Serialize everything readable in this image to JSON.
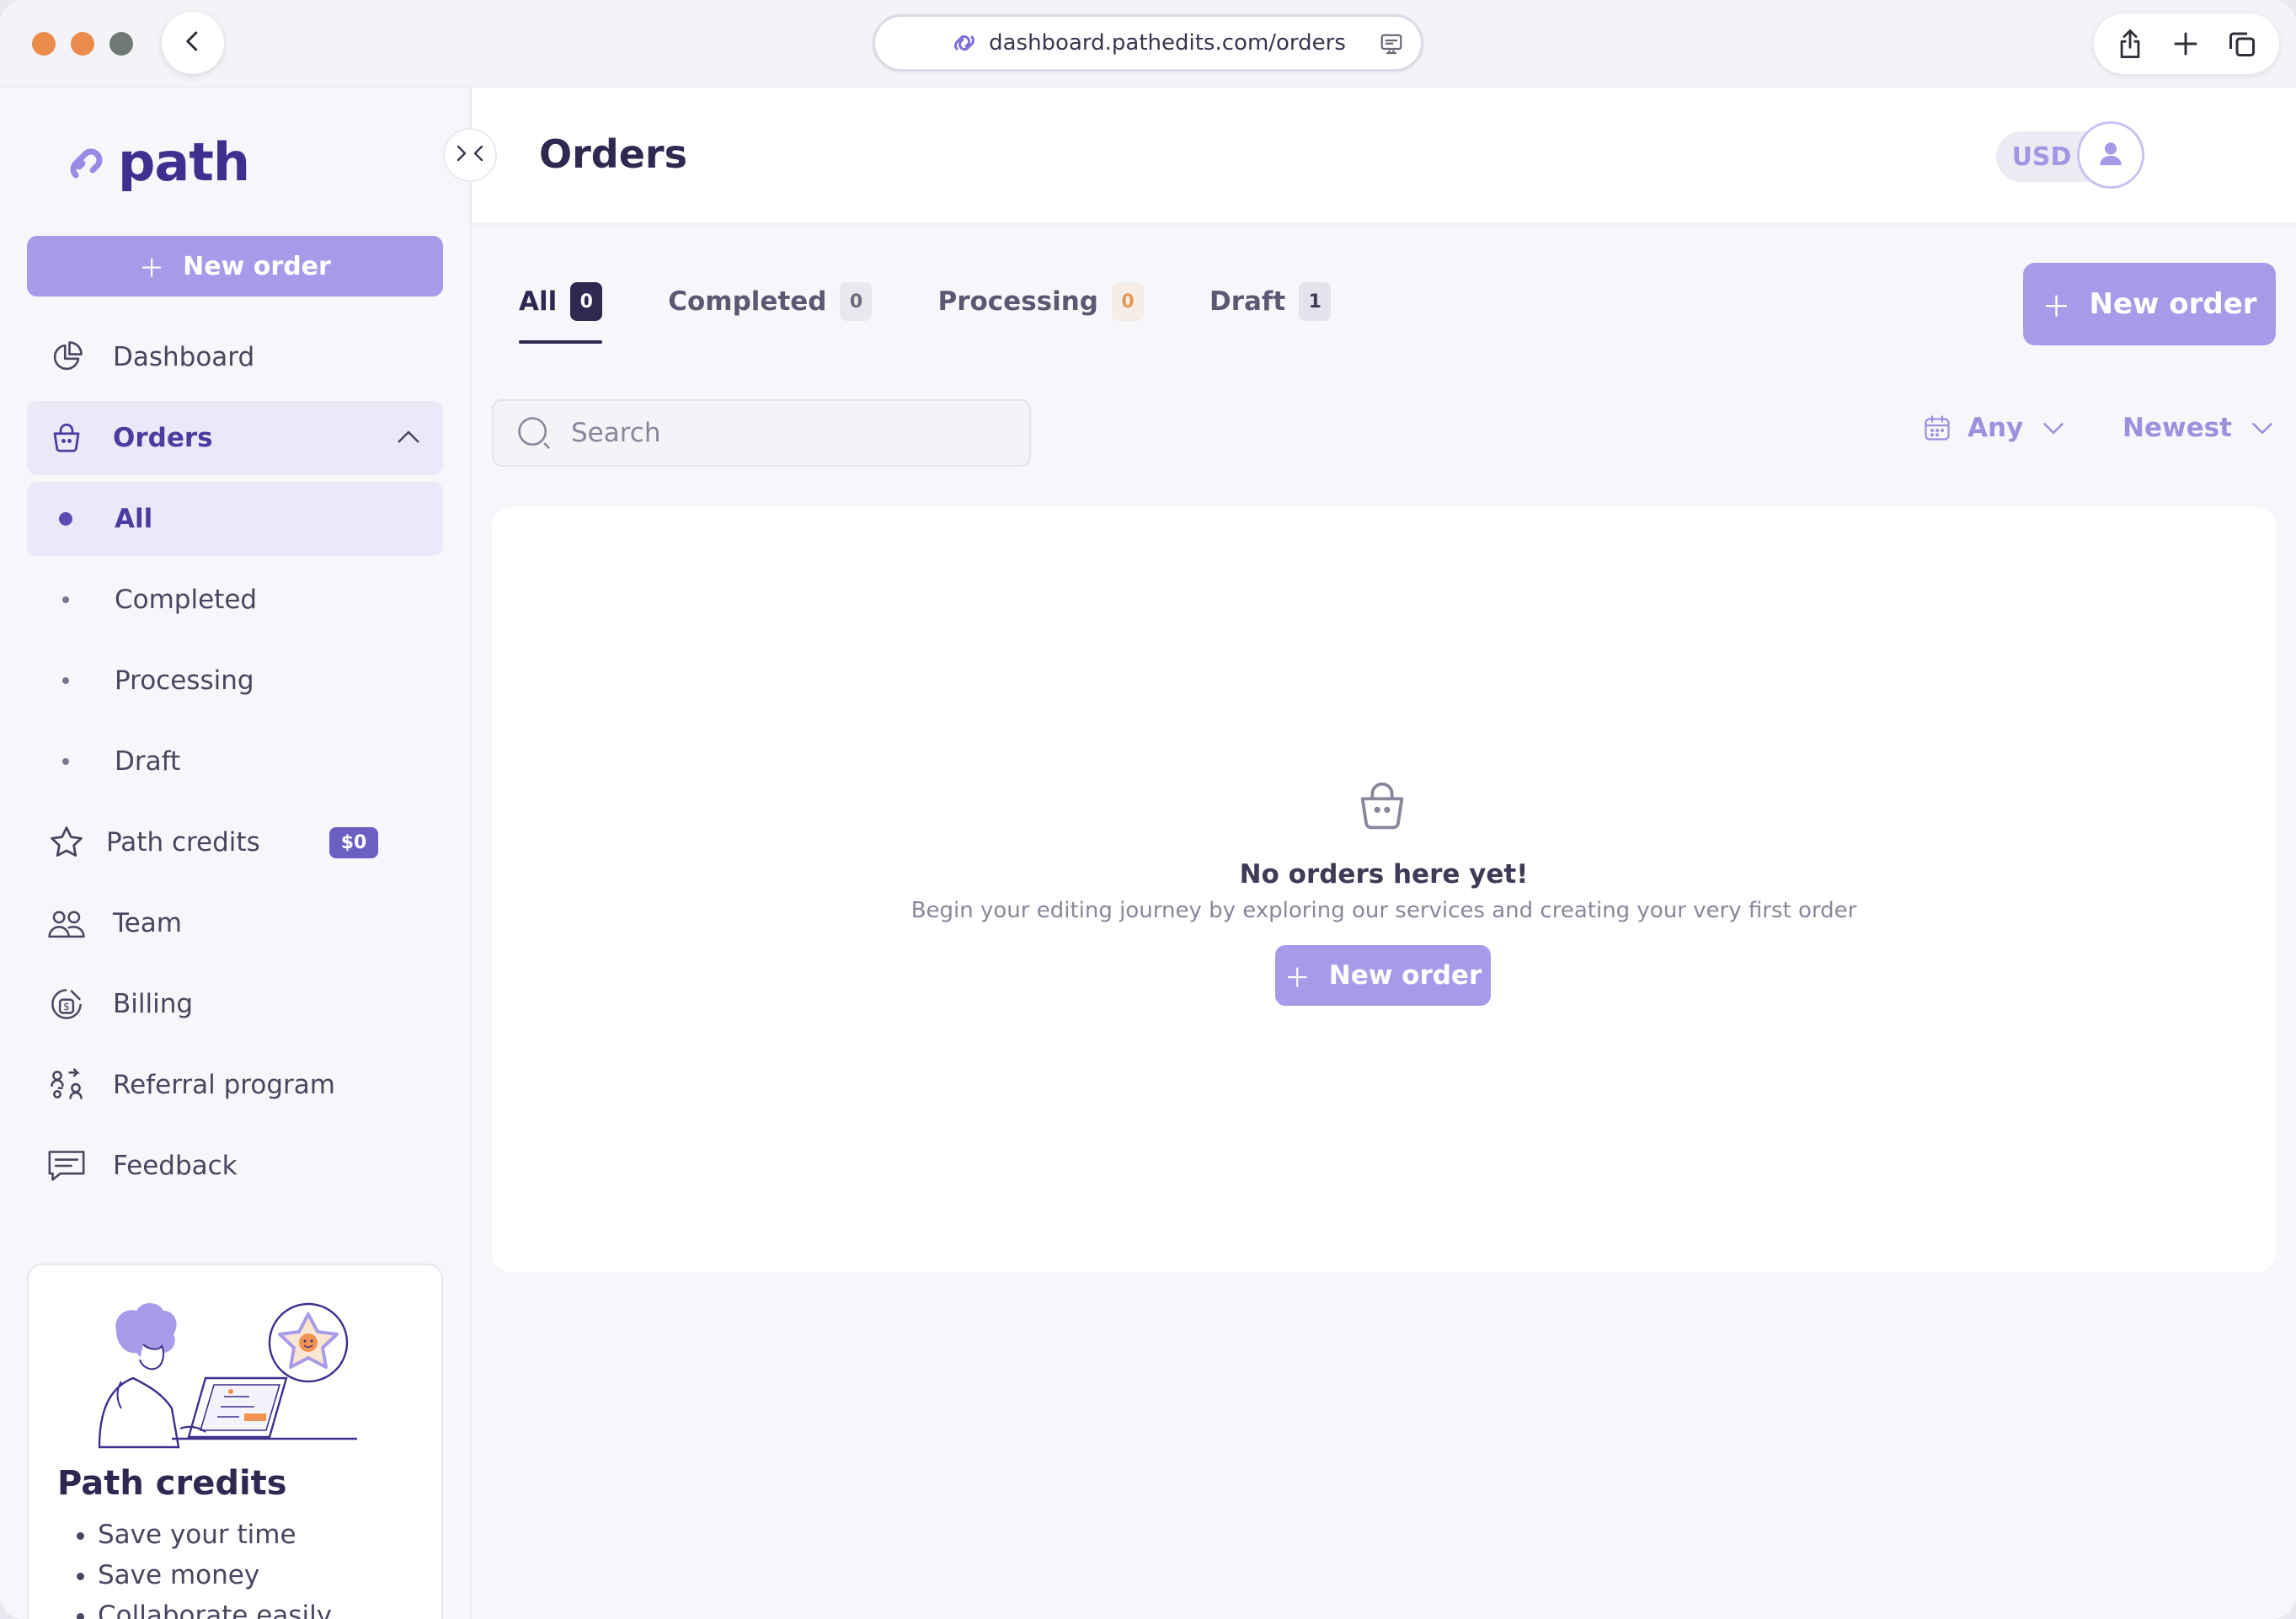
{
  "browser": {
    "url": "dashboard.pathedits.com/orders"
  },
  "brand": {
    "logo_text": "path",
    "accent": "#a89ae8",
    "dark": "#2f2850"
  },
  "sidebar": {
    "new_order_label": "New order",
    "items": [
      {
        "label": "Dashboard",
        "icon": "pie-chart-icon"
      },
      {
        "label": "Orders",
        "icon": "basket-icon"
      },
      {
        "label": "All"
      },
      {
        "label": "Completed"
      },
      {
        "label": "Processing"
      },
      {
        "label": "Draft"
      },
      {
        "label": "Path credits",
        "icon": "star-icon",
        "badge": "$0"
      },
      {
        "label": "Team",
        "icon": "team-icon"
      },
      {
        "label": "Billing",
        "icon": "billing-icon"
      },
      {
        "label": "Referral program",
        "icon": "referral-icon"
      },
      {
        "label": "Feedback",
        "icon": "feedback-icon"
      }
    ],
    "promo": {
      "title": "Path credits",
      "bullets": [
        "Save your time",
        "Save money",
        "Collaborate easily"
      ]
    }
  },
  "header": {
    "title": "Orders",
    "currency": "USD"
  },
  "tabs": [
    {
      "label": "All",
      "count": "0"
    },
    {
      "label": "Completed",
      "count": "0"
    },
    {
      "label": "Processing",
      "count": "0"
    },
    {
      "label": "Draft",
      "count": "1"
    }
  ],
  "toolbar": {
    "new_order_label": "New order",
    "search_placeholder": "Search",
    "date_filter": "Any",
    "sort": "Newest"
  },
  "empty_state": {
    "title": "No orders here yet!",
    "subtitle": "Begin your editing journey by exploring our services and creating your very first order",
    "button_label": "New order"
  }
}
